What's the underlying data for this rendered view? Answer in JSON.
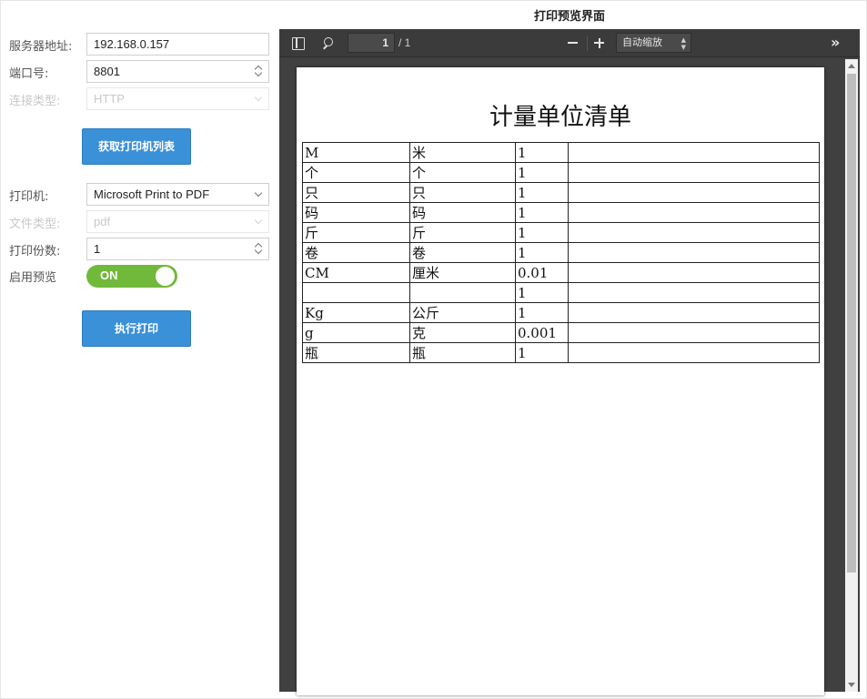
{
  "form": {
    "server_address_label": "服务器地址:",
    "server_address_value": "192.168.0.157",
    "port_label": "端口号:",
    "port_value": "8801",
    "connection_type_label": "连接类型:",
    "connection_type_value": "HTTP",
    "get_printers_button": "获取打印机列表",
    "printer_label": "打印机:",
    "printer_value": "Microsoft Print to PDF",
    "file_type_label": "文件类型:",
    "file_type_value": "pdf",
    "copies_label": "打印份数:",
    "copies_value": "1",
    "enable_preview_label": "启用预览",
    "enable_preview_toggle": "ON",
    "print_button": "执行打印"
  },
  "preview": {
    "title": "打印预览界面",
    "toolbar": {
      "current_page": "1",
      "page_count": "/ 1",
      "zoom_option": "自动缩放"
    },
    "document": {
      "title": "计量单位清单",
      "rows": [
        [
          "M",
          "米",
          "1",
          ""
        ],
        [
          "个",
          "个",
          "1",
          ""
        ],
        [
          "只",
          "只",
          "1",
          ""
        ],
        [
          "码",
          "码",
          "1",
          ""
        ],
        [
          "斤",
          "斤",
          "1",
          ""
        ],
        [
          "卷",
          "卷",
          "1",
          ""
        ],
        [
          "CM",
          "厘米",
          "0.01",
          ""
        ],
        [
          "",
          "",
          "1",
          ""
        ],
        [
          "Kg",
          "公斤",
          "1",
          ""
        ],
        [
          "g",
          "克",
          "0.001",
          ""
        ],
        [
          "瓶",
          "瓶",
          "1",
          ""
        ]
      ]
    }
  },
  "colors": {
    "primary_button": "#3a91d8",
    "toggle_on": "#71b93a",
    "viewer_background": "#404040",
    "viewer_toolbar": "#3b3b3b"
  },
  "icons": [
    "sidebar-toggle-icon",
    "search-icon",
    "zoom-out-icon",
    "zoom-in-icon",
    "more-tools-icon",
    "spinner-icon",
    "chevron-down-icon"
  ]
}
